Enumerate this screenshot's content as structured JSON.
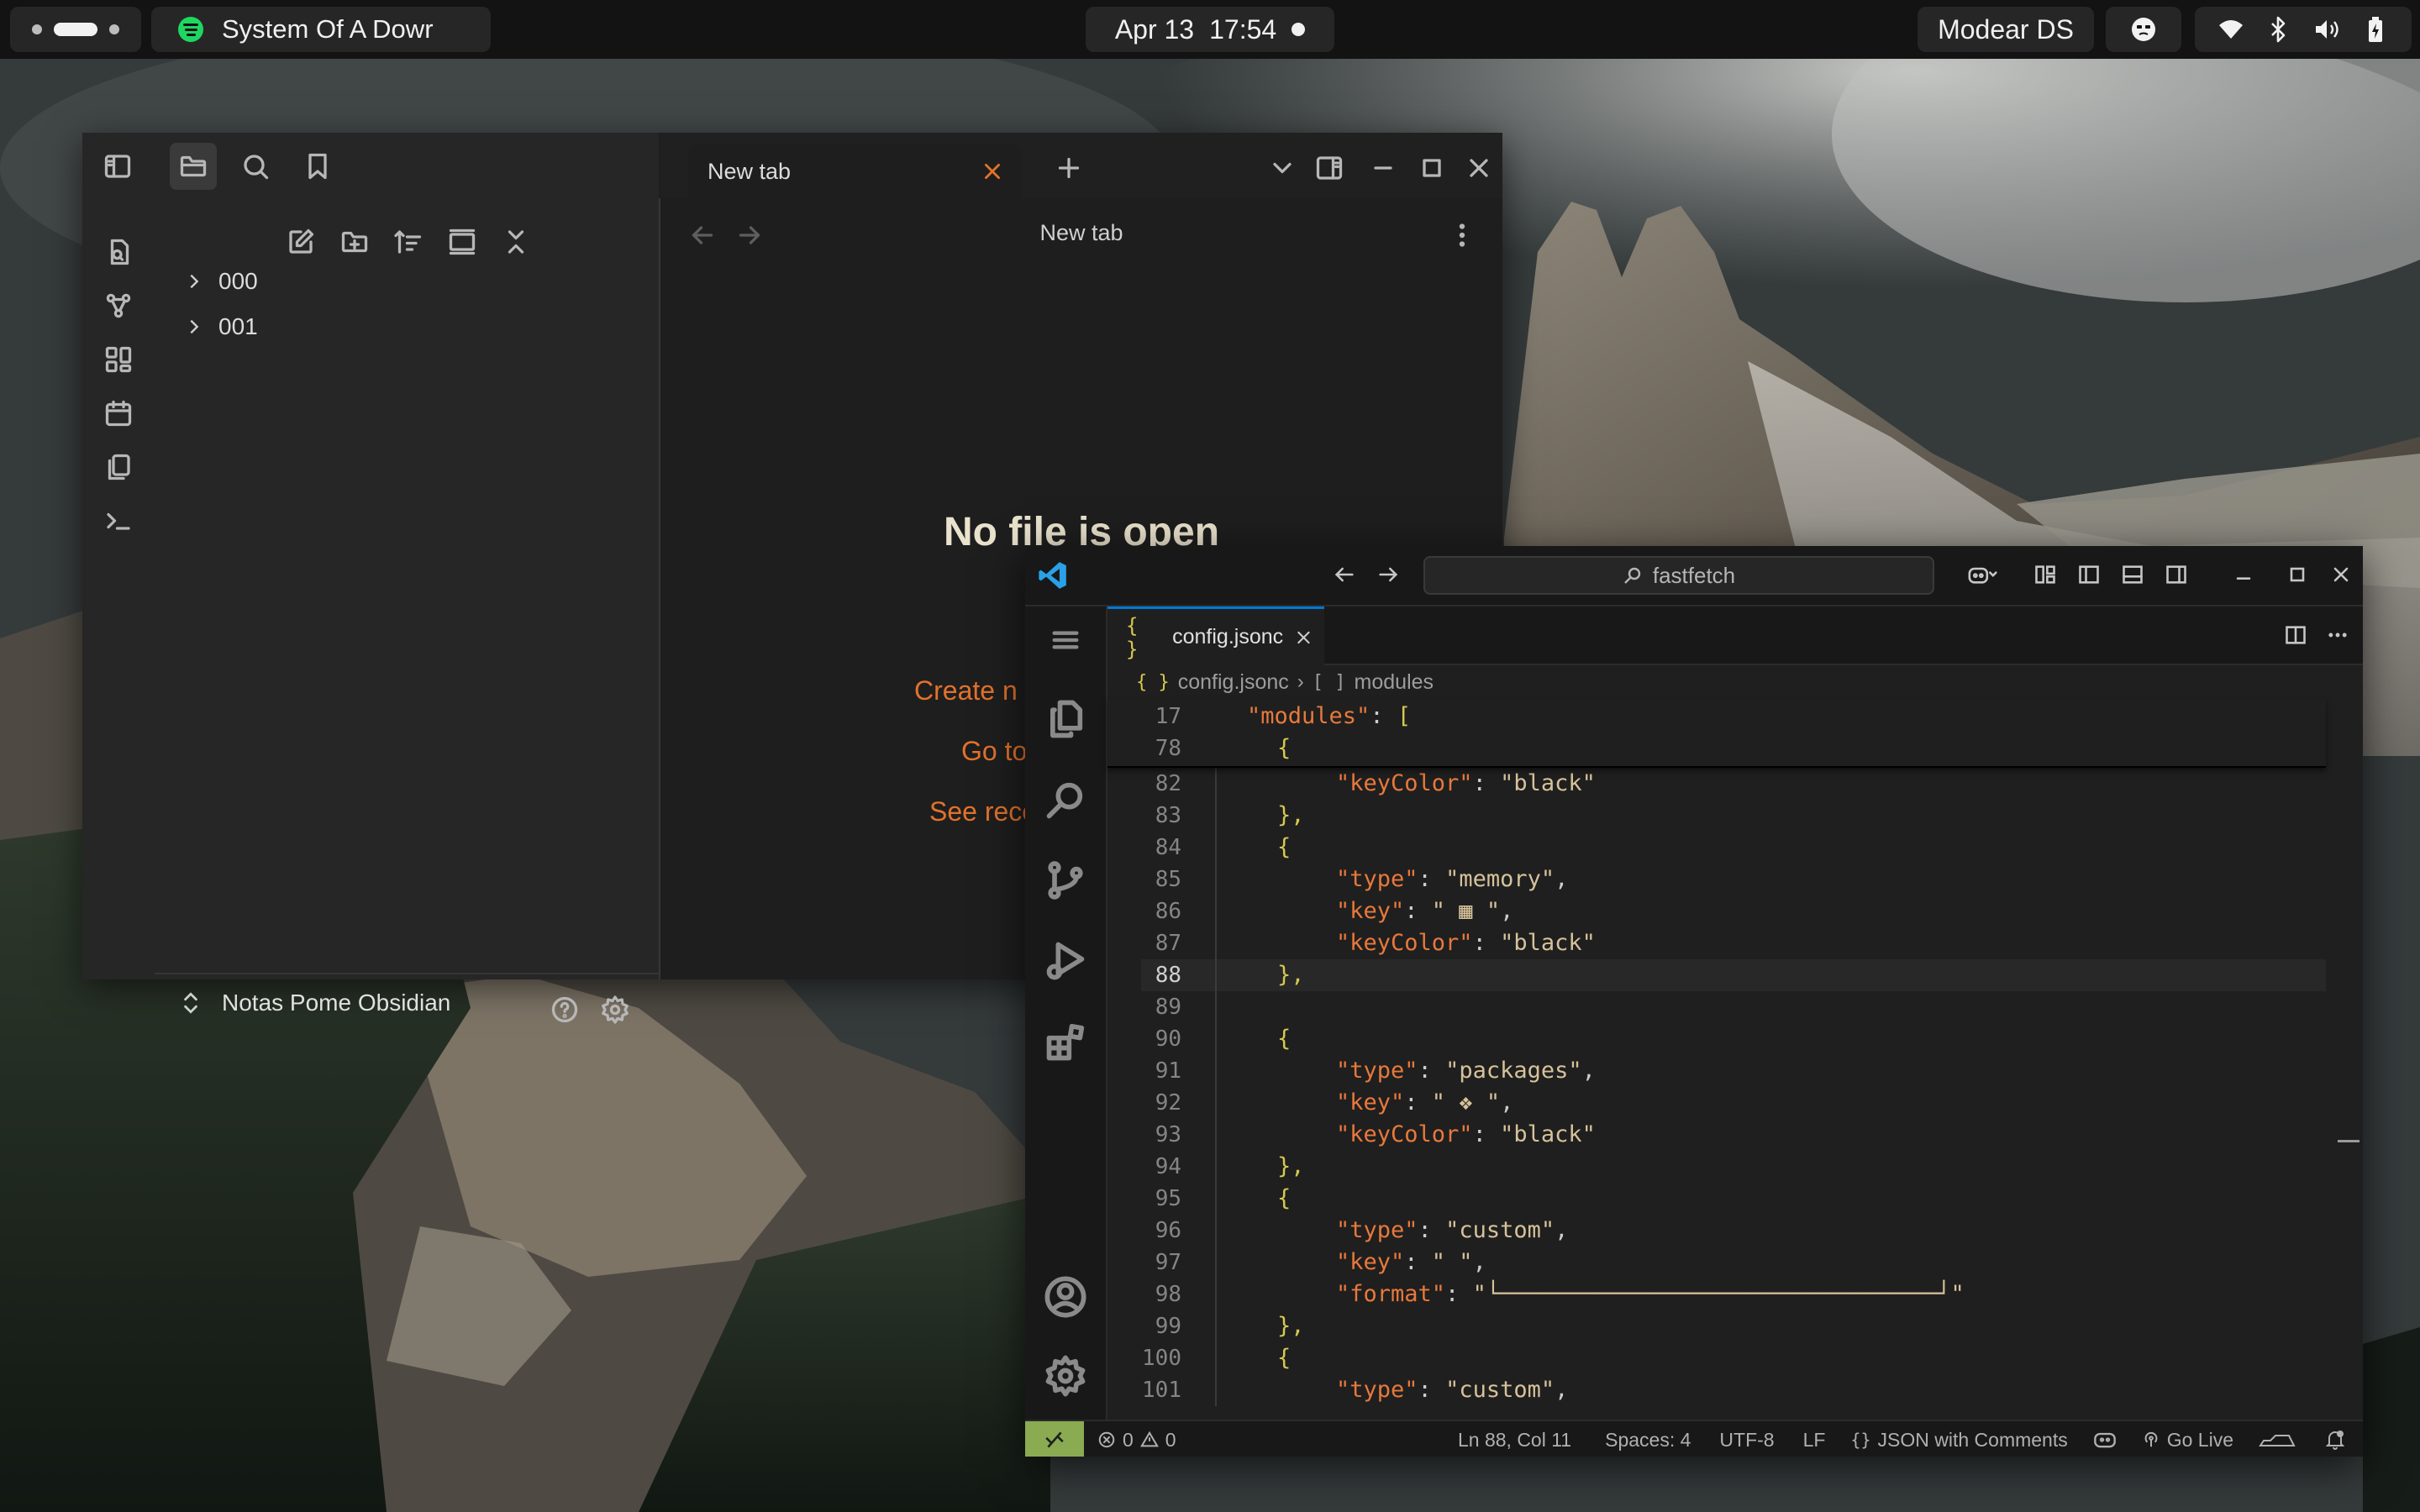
{
  "topbar": {
    "media_title": "System Of A Dowr",
    "date": "Apr 13",
    "time": "17:54",
    "username": "Modear DS"
  },
  "obsidian": {
    "tab_label": "New tab",
    "header_title": "New tab",
    "folders": [
      "000",
      "001"
    ],
    "empty_title": "No file is open",
    "links": [
      "Create n",
      "Go to",
      "See rece"
    ],
    "vault_name": "Notas Pome Obsidian"
  },
  "vscode": {
    "search": "fastfetch",
    "tab_label": "config.jsonc",
    "breadcrumb": {
      "file": "config.jsonc",
      "symbol": "modules",
      "file_icon": "{ }",
      "symbol_icon": "[ ]"
    },
    "sticky": [
      {
        "n": "17",
        "text": "\"modules\": ["
      },
      {
        "n": "78",
        "text": "{"
      }
    ],
    "lines": [
      {
        "n": "82",
        "key": "keyColor",
        "val": "black",
        "trail": ""
      },
      {
        "n": "83",
        "raw": "},"
      },
      {
        "n": "84",
        "raw": "{"
      },
      {
        "n": "85",
        "key": "type",
        "val": "memory",
        "trail": ","
      },
      {
        "n": "86",
        "key": "key",
        "val": " ▦ ",
        "trail": ","
      },
      {
        "n": "87",
        "key": "keyColor",
        "val": "black",
        "trail": ""
      },
      {
        "n": "88",
        "raw": "},"
      },
      {
        "n": "89",
        "raw": ""
      },
      {
        "n": "90",
        "raw": "{"
      },
      {
        "n": "91",
        "key": "type",
        "val": "packages",
        "trail": ","
      },
      {
        "n": "92",
        "key": "key",
        "val": " ❖ ",
        "trail": ","
      },
      {
        "n": "93",
        "key": "keyColor",
        "val": "black",
        "trail": ""
      },
      {
        "n": "94",
        "raw": "},"
      },
      {
        "n": "95",
        "raw": "{"
      },
      {
        "n": "96",
        "key": "type",
        "val": "custom",
        "trail": ","
      },
      {
        "n": "97",
        "key": "key",
        "val": " ",
        "trail": ","
      },
      {
        "n": "98",
        "key": "format",
        "val": "└────────────────────────────────┘",
        "trail": ""
      },
      {
        "n": "99",
        "raw": "},"
      },
      {
        "n": "100",
        "raw": "{"
      },
      {
        "n": "101",
        "key": "type",
        "val": "custom",
        "trail": ","
      }
    ],
    "status": {
      "errors": "0",
      "warnings": "0",
      "position": "Ln 88, Col 11",
      "spaces": "Spaces: 4",
      "encoding": "UTF-8",
      "eol": "LF",
      "language": "JSON with Comments",
      "go_live": "Go Live"
    }
  }
}
